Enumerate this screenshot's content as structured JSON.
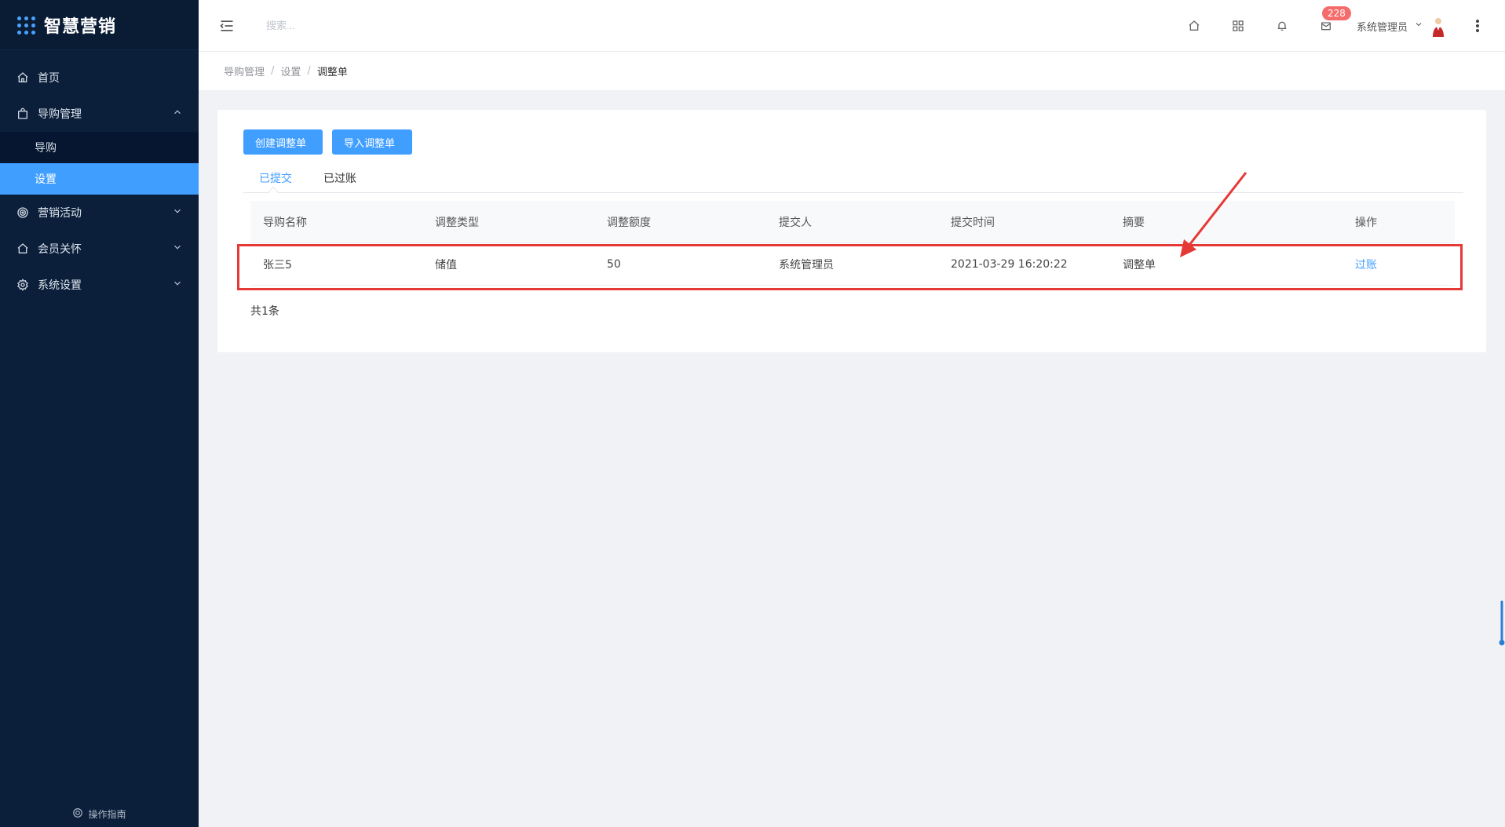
{
  "app": {
    "title": "智慧营销"
  },
  "sidebar": {
    "items": [
      {
        "label": "首页",
        "icon": "home-icon"
      },
      {
        "label": "导购管理",
        "icon": "bag-icon",
        "expanded": true,
        "children": [
          {
            "label": "导购"
          },
          {
            "label": "设置",
            "active": true
          }
        ]
      },
      {
        "label": "营销活动",
        "icon": "target-icon"
      },
      {
        "label": "会员关怀",
        "icon": "home-icon"
      },
      {
        "label": "系统设置",
        "icon": "gear-icon"
      }
    ],
    "guide_label": "操作指南"
  },
  "header": {
    "search": {
      "placeholder": "搜索..."
    },
    "badge_count": "228",
    "user_name": "系统管理员"
  },
  "breadcrumb": {
    "items": [
      "导购管理",
      "设置",
      "调整单"
    ]
  },
  "main": {
    "buttons": {
      "create": "创建调整单",
      "import": "导入调整单"
    },
    "tabs": [
      {
        "label": "已提交",
        "active": true
      },
      {
        "label": "已过账"
      }
    ],
    "table": {
      "headers": [
        "导购名称",
        "调整类型",
        "调整额度",
        "提交人",
        "提交时间",
        "摘要",
        "操作"
      ],
      "rows": [
        {
          "name": "张三5",
          "type": "储值",
          "amount": "50",
          "submitter": "系统管理员",
          "time": "2021-03-29 16:20:22",
          "summary": "调整单",
          "action": "过账"
        }
      ]
    },
    "total": "共1条"
  },
  "colors": {
    "sidebar_bg": "#0b1f3a",
    "primary": "#409eff",
    "annotation_red": "#e53935"
  }
}
